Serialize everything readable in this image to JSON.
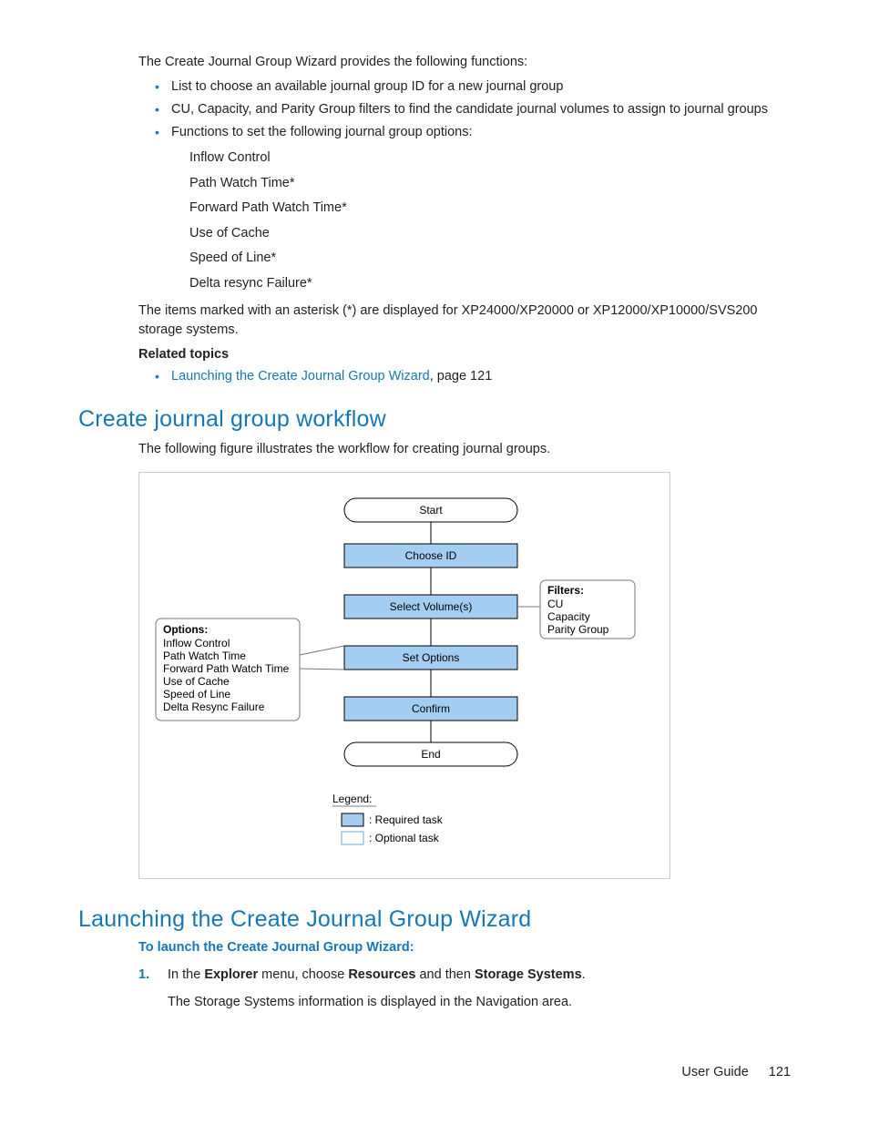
{
  "intro": "The Create Journal Group Wizard provides the following functions:",
  "functions": [
    "List to choose an available journal group ID for a new journal group",
    "CU, Capacity, and Parity Group filters to find the candidate journal volumes to assign to journal groups",
    "Functions to set the following journal group options:"
  ],
  "options": [
    "Inflow Control",
    "Path Watch Time*",
    "Forward Path Watch Time*",
    "Use of Cache",
    "Speed of Line*",
    "Delta resync Failure*"
  ],
  "asterisk_note": "The items marked with an asterisk (*) are displayed for XP24000/XP20000 or XP12000/XP10000/SVS200 storage systems.",
  "related_topics_hdr": "Related topics",
  "related_link_text": "Launching the Create Journal Group Wizard",
  "related_link_suffix": ", page 121",
  "workflow_heading": "Create journal group workflow",
  "workflow_intro": "The following figure illustrates the workflow for creating journal groups.",
  "chart_data": {
    "type": "flowchart",
    "nodes": [
      {
        "id": "start",
        "label": "Start",
        "shape": "terminator"
      },
      {
        "id": "choose_id",
        "label": "Choose ID",
        "shape": "process_required"
      },
      {
        "id": "select_vol",
        "label": "Select Volume(s)",
        "shape": "process_required"
      },
      {
        "id": "set_options",
        "label": "Set Options",
        "shape": "process_required"
      },
      {
        "id": "confirm",
        "label": "Confirm",
        "shape": "process_required"
      },
      {
        "id": "end",
        "label": "End",
        "shape": "terminator"
      }
    ],
    "callouts": {
      "options_box": {
        "title": "Options:",
        "items": [
          "Inflow Control",
          "Path Watch Time",
          "Forward Path Watch Time",
          "Use of Cache",
          "Speed of Line",
          "Delta Resync Failure"
        ],
        "points_to": "set_options"
      },
      "filters_box": {
        "title": "Filters:",
        "items": [
          "CU",
          "Capacity",
          "Parity Group"
        ],
        "points_to": "select_vol"
      }
    },
    "legend": {
      "title": "Legend:",
      "required": ": Required task",
      "optional": ": Optional task"
    }
  },
  "launch_heading": "Launching the Create Journal Group Wizard",
  "launch_sub_hdr": "To launch the Create Journal Group Wizard:",
  "step1_num": "1.",
  "step1_pre": "In the ",
  "step1_b1": "Explorer",
  "step1_mid1": " menu, choose ",
  "step1_b2": "Resources",
  "step1_mid2": " and then ",
  "step1_b3": "Storage Systems",
  "step1_end": ".",
  "step1_sub": "The Storage Systems information is displayed in the Navigation area.",
  "footer_text": "User Guide",
  "footer_page": "121"
}
